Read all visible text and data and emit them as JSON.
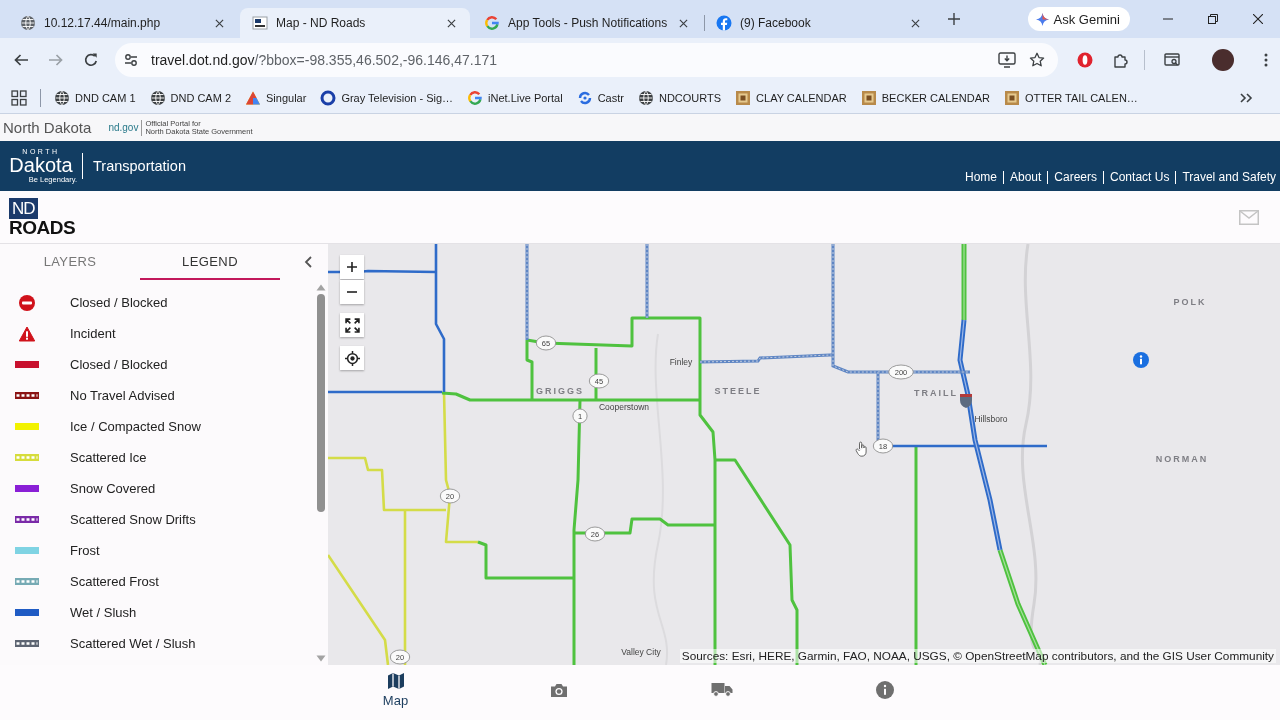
{
  "browser": {
    "tabs": [
      {
        "title": "10.12.17.44/main.php",
        "selected": false
      },
      {
        "title": "Map - ND Roads",
        "selected": true
      },
      {
        "title": "App Tools - Push Notifications",
        "selected": false
      },
      {
        "title": "(9) Facebook",
        "selected": false
      }
    ],
    "gemini_button": "Ask Gemini",
    "address": {
      "host": "travel.dot.nd.gov",
      "path": "/?bbox=-98.355,46.502,-96.146,47.171"
    },
    "bookmarks": [
      "DND CAM 1",
      "DND CAM 2",
      "Singular",
      "Gray Television - Sig…",
      "iNet.Live Portal",
      "Castr",
      "NDCOURTS",
      "CLAY CALENDAR",
      "BECKER CALENDAR",
      "OTTER TAIL CALEN…"
    ]
  },
  "portal_bar": {
    "state_name": "North Dakota",
    "link": "nd.gov",
    "tagline": [
      "Official Portal for",
      "North Dakota State Government"
    ]
  },
  "header": {
    "logo": {
      "top": "NORTH",
      "main": "Dakota",
      "motto": "Be Legendary."
    },
    "section": "Transportation",
    "nav": [
      "Home",
      "About",
      "Careers",
      "Contact Us",
      "Travel and Safety"
    ]
  },
  "app_bar": {
    "logo": {
      "initials": "ND",
      "word": "ROADS"
    }
  },
  "panel": {
    "tabs": [
      {
        "label": "LAYERS",
        "selected": false
      },
      {
        "label": "LEGEND",
        "selected": true
      }
    ],
    "legend": [
      {
        "kind": "closed",
        "label": "Closed / Blocked"
      },
      {
        "kind": "incident",
        "label": "Incident"
      },
      {
        "kind": "solid",
        "label": "Closed / Blocked",
        "color": "#c8102e"
      },
      {
        "kind": "scattered",
        "label": "No Travel Advised",
        "color": "#8b1414"
      },
      {
        "kind": "solid",
        "label": "Ice / Compacted Snow",
        "color": "#f2f200"
      },
      {
        "kind": "scattered",
        "label": "Scattered Ice",
        "color": "#d6dc3c"
      },
      {
        "kind": "solid",
        "label": "Snow Covered",
        "color": "#8a1fd6"
      },
      {
        "kind": "scattered",
        "label": "Scattered Snow Drifts",
        "color": "#7a2aa8"
      },
      {
        "kind": "solid",
        "label": "Frost",
        "color": "#7fd3e3"
      },
      {
        "kind": "scattered",
        "label": "Scattered Frost",
        "color": "#76aab4"
      },
      {
        "kind": "solid",
        "label": "Wet / Slush",
        "color": "#1f5bc4"
      },
      {
        "kind": "scattered",
        "label": "Scattered Wet / Slush",
        "color": "#5d6472"
      }
    ]
  },
  "map": {
    "counties": [
      "GRIGGS",
      "STEELE",
      "TRAILL",
      "POLK",
      "NORMAN"
    ],
    "towns": [
      "Finley",
      "Cooperstown",
      "Hillsboro",
      "Valley City"
    ],
    "route_shields": [
      "65",
      "45",
      "1",
      "20",
      "20",
      "26",
      "200",
      "18"
    ],
    "attribution": "Sources: Esri, HERE, Garmin, FAO, NOAA, USGS, © OpenStreetMap contributors, and the GIS User Community"
  },
  "bottom_nav": [
    {
      "label": "Map",
      "selected": true
    },
    {
      "selected": false
    },
    {
      "selected": false
    },
    {
      "selected": false
    }
  ]
}
